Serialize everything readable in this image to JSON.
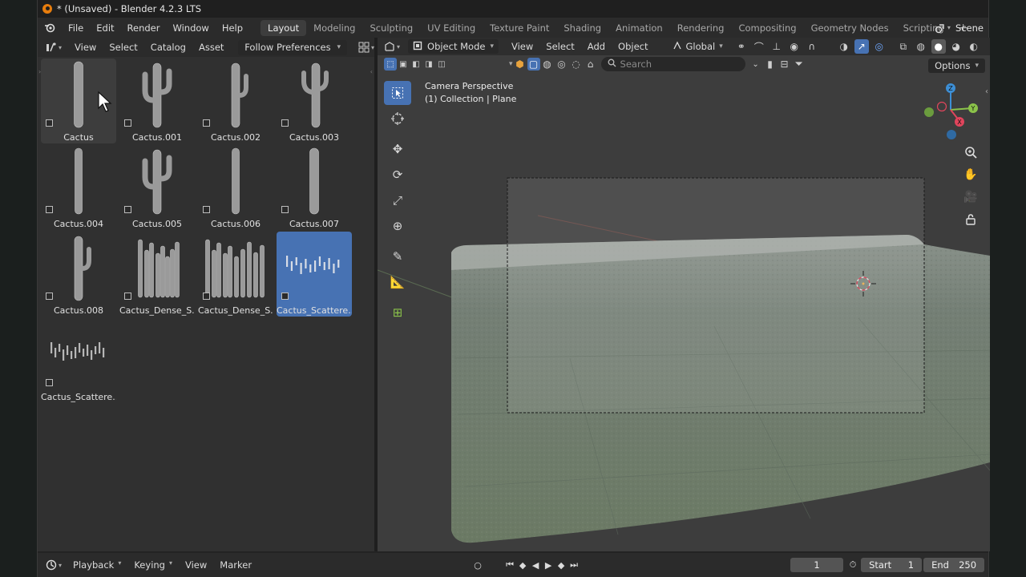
{
  "window": {
    "title": "* (Unsaved) - Blender 4.2.3 LTS"
  },
  "menubar": {
    "items": [
      "File",
      "Edit",
      "Render",
      "Window",
      "Help"
    ],
    "workspaces": [
      "Layout",
      "Modeling",
      "Sculpting",
      "UV Editing",
      "Texture Paint",
      "Shading",
      "Animation",
      "Rendering",
      "Compositing",
      "Geometry Nodes",
      "Scripting"
    ],
    "active_workspace": "Layout",
    "add_tab": "+",
    "scene_name": "Scene"
  },
  "asset_browser": {
    "menus": [
      "View",
      "Select",
      "Catalog",
      "Asset"
    ],
    "library_dropdown": "Follow Preferences",
    "assets": [
      {
        "label": "Cactus",
        "state": "hover",
        "kind": "column"
      },
      {
        "label": "Cactus.001",
        "state": "",
        "kind": "saguaro"
      },
      {
        "label": "Cactus.002",
        "state": "",
        "kind": "saguaro2"
      },
      {
        "label": "Cactus.003",
        "state": "",
        "kind": "saguaro3"
      },
      {
        "label": "Cactus.004",
        "state": "",
        "kind": "column2"
      },
      {
        "label": "Cactus.005",
        "state": "",
        "kind": "saguaro"
      },
      {
        "label": "Cactus.006",
        "state": "",
        "kind": "column2"
      },
      {
        "label": "Cactus.007",
        "state": "",
        "kind": "column"
      },
      {
        "label": "Cactus.008",
        "state": "",
        "kind": "saguaro2"
      },
      {
        "label": "Cactus_Dense_S...",
        "state": "",
        "kind": "dense"
      },
      {
        "label": "Cactus_Dense_S...",
        "state": "",
        "kind": "dense2"
      },
      {
        "label": "Cactus_Scattere...",
        "state": "selected",
        "kind": "scatter"
      },
      {
        "label": "Cactus_Scattere...",
        "state": "",
        "kind": "scatter2"
      }
    ]
  },
  "viewport": {
    "mode": "Object Mode",
    "menus": [
      "View",
      "Select",
      "Add",
      "Object"
    ],
    "transform_orientation": "Global",
    "search_placeholder": "Search",
    "options_label": "Options",
    "overlay_line1": "Camera Perspective",
    "overlay_line2": "(1) Collection | Plane",
    "gizmo_axes": [
      "Z",
      "Y",
      "X"
    ]
  },
  "timeline": {
    "menus": [
      "Playback",
      "Keying",
      "View",
      "Marker"
    ],
    "current_frame": "1",
    "start_label": "Start",
    "start_value": "1",
    "end_label": "End",
    "end_value": "250"
  },
  "colors": {
    "accent": "#4772b3",
    "blender_orange": "#e87d0d",
    "axis_x": "#e0455c",
    "axis_y": "#8bc34a",
    "axis_z": "#3d8fd6"
  }
}
